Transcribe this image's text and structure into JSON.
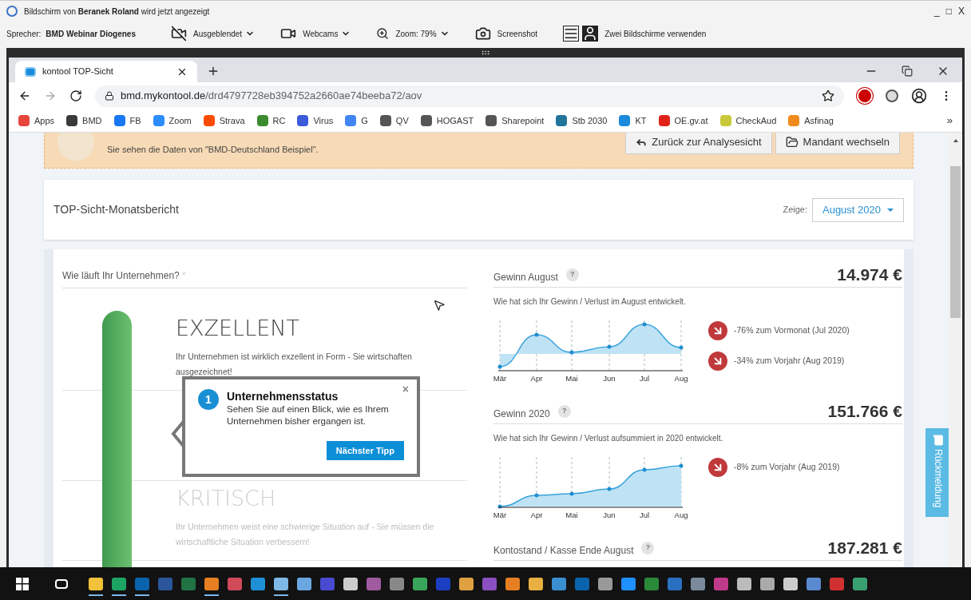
{
  "screen_share": {
    "notice": "Bildschirm von **Beranek Roland** wird jetzt angezeigt",
    "window_controls": [
      "_",
      "□",
      "X"
    ],
    "speaker_label": "Sprecher:",
    "speaker": "BMD Webinar Diogenes",
    "tools": [
      {
        "kind": "camera_off",
        "label": "Ausgeblendet",
        "dropdown": true
      },
      {
        "kind": "webcam",
        "label": "Webcams",
        "dropdown": true
      },
      {
        "kind": "zoom",
        "label": "Zoom: 79%",
        "dropdown": true
      },
      {
        "kind": "screenshot",
        "label": "Screenshot",
        "dropdown": false
      },
      {
        "kind": "dual",
        "label": "Zwei Bildschirme verwenden",
        "dropdown": false
      }
    ]
  },
  "browser": {
    "tab": {
      "title": "kontool TOP-Sicht"
    },
    "url": {
      "host": "bmd.mykontool.de",
      "path": "/drd4797728eb394752a2660ae74beeba72/aov"
    },
    "bookmarks": [
      {
        "label": "Apps",
        "color": "#e8453c"
      },
      {
        "label": "BMD",
        "color": "#3a3a3a"
      },
      {
        "label": "FB",
        "color": "#1877f2"
      },
      {
        "label": "Zoom",
        "color": "#2d8cff"
      },
      {
        "label": "Strava",
        "color": "#fc4c02"
      },
      {
        "label": "RC",
        "color": "#3d8b2f"
      },
      {
        "label": "Virus",
        "color": "#3b5bdb"
      },
      {
        "label": "G",
        "color": "#4285f4"
      },
      {
        "label": "QV",
        "color": "#555555"
      },
      {
        "label": "HOGAST",
        "color": "#555555"
      },
      {
        "label": "Sharepoint",
        "color": "#555555"
      },
      {
        "label": "Stb 2030",
        "color": "#21759b"
      },
      {
        "label": "KT",
        "color": "#1c8adb"
      },
      {
        "label": "OE.gv.at",
        "color": "#e2231a"
      },
      {
        "label": "CheckAud",
        "color": "#c9c93a"
      },
      {
        "label": "Asfinag",
        "color": "#f08a1c"
      }
    ],
    "bookmarks_more": "»"
  },
  "page": {
    "banner": {
      "text": "Sie sehen die Daten von \"BMD-Deutschland Beispiel\".",
      "buttons": [
        {
          "kind": "back",
          "label": "Zurück zur Analysesicht"
        },
        {
          "kind": "folder",
          "label": "Mandant wechseln"
        }
      ]
    },
    "header": {
      "title": "TOP-Sicht-Monatsbericht",
      "show_label": "Zeige:",
      "period": "August 2020"
    },
    "status": {
      "question": "Wie läuft Ihr Unternehmen?",
      "asterisk": "*",
      "levels": [
        {
          "title": "EXZELLENT",
          "text": "Ihr Unternehmen ist wirklich exzellent in Form - Sie wirtschaften ausgezeichnet!",
          "active": true
        },
        {
          "title": "KRITISCH",
          "text": "Ihr Unternehmen weist eine schwierige Situation auf - Sie müssen die wirtschaftliche Situation verbessern!",
          "active": false
        }
      ]
    },
    "tip": {
      "step": "1",
      "title": "Unternehmensstatus",
      "text": "Sehen Sie auf einen Blick, wie es Ihrem Unternehmen bisher ergangen ist.",
      "button": "Nächster Tipp",
      "close": "×"
    },
    "metrics": [
      {
        "title": "Gewinn August",
        "help": "?",
        "value": "14.974 €",
        "subtitle": "Wie hat sich Ihr Gewinn / Verlust im August entwickelt.",
        "x_labels": [
          "Mär",
          "Apr",
          "Mai",
          "Jun",
          "Jul",
          "Aug"
        ],
        "changes": [
          {
            "kind": "down",
            "text": "-76% zum Vormonat (Jul 2020)"
          },
          {
            "kind": "down",
            "text": "-34% zum Vorjahr (Aug 2019)"
          }
        ]
      },
      {
        "title": "Gewinn 2020",
        "help": "?",
        "value": "151.766 €",
        "subtitle": "Wie hat sich Ihr Gewinn / Verlust aufsummiert in 2020 entwickelt.",
        "x_labels": [
          "Mär",
          "Apr",
          "Mai",
          "Jun",
          "Jul",
          "Aug"
        ],
        "changes": [
          {
            "kind": "down",
            "text": "-8% zum Vorjahr (Aug 2019)"
          }
        ]
      },
      {
        "title": "Kontostand / Kasse Ende August",
        "help": "?",
        "value": "187.281 €"
      }
    ],
    "feedback": "Rückmeldung"
  },
  "taskbar": {
    "apps": [
      {
        "color": "#f3c13a",
        "running": true
      },
      {
        "color": "#1da462",
        "running": true
      },
      {
        "color": "#0a64ad",
        "running": true
      },
      {
        "color": "#2b579a",
        "running": false
      },
      {
        "color": "#217346",
        "running": false
      },
      {
        "color": "#e67e22",
        "running": true
      },
      {
        "color": "#d04a5a",
        "running": false
      },
      {
        "color": "#1e90d6",
        "running": false
      },
      {
        "color": "#7fb8e6",
        "running": true
      },
      {
        "color": "#6aa7e0",
        "running": false
      },
      {
        "color": "#4a4ad0",
        "running": false
      },
      {
        "color": "#cccccc",
        "running": false
      },
      {
        "color": "#a05aa0",
        "running": false
      },
      {
        "color": "#888888",
        "running": false
      },
      {
        "color": "#3aa55a",
        "running": false
      },
      {
        "color": "#1a3fc0",
        "running": false
      },
      {
        "color": "#e0a040",
        "running": false
      },
      {
        "color": "#8a4fc0",
        "running": false
      },
      {
        "color": "#e67e22",
        "running": false
      },
      {
        "color": "#e8b040",
        "running": false
      },
      {
        "color": "#3a8fd0",
        "running": false
      },
      {
        "color": "#0a64ad",
        "running": false
      },
      {
        "color": "#999999",
        "running": false
      },
      {
        "color": "#1e90ff",
        "running": false
      },
      {
        "color": "#2a8a3a",
        "running": false
      },
      {
        "color": "#2a70c0",
        "running": false
      },
      {
        "color": "#7a8a9a",
        "running": false
      },
      {
        "color": "#c03a8a",
        "running": false
      },
      {
        "color": "#bbbbbb",
        "running": false
      },
      {
        "color": "#aaaaaa",
        "running": false
      },
      {
        "color": "#cccccc",
        "running": false
      },
      {
        "color": "#5a8ad0",
        "running": false
      },
      {
        "color": "#d03030",
        "running": false
      },
      {
        "color": "#3aa070",
        "running": false
      }
    ]
  }
}
